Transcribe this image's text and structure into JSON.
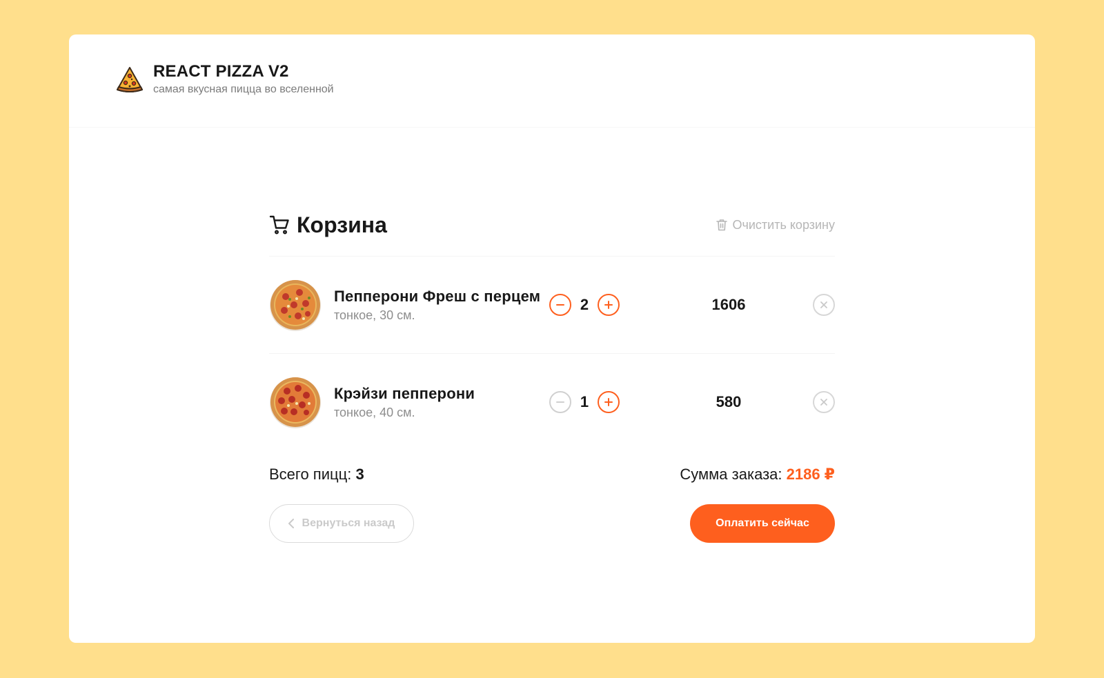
{
  "header": {
    "logo_icon": "pizza-slice-icon",
    "title": "REACT PIZZA V2",
    "subtitle": "самая вкусная пицца во вселенной"
  },
  "cart": {
    "title": "Корзина",
    "title_icon": "cart-icon",
    "clear_label": "Очистить корзину",
    "clear_icon": "trash-icon",
    "items": [
      {
        "name": "Пепперони Фреш с перцем",
        "desc": "тонкое, 30 см.",
        "count": "2",
        "price": "1606",
        "image_icon": "pizza-image",
        "minus_disabled": false
      },
      {
        "name": "Крэйзи пепперони",
        "desc": "тонкое, 40 см.",
        "count": "1",
        "price": "580",
        "image_icon": "pizza-image",
        "minus_disabled": true
      }
    ],
    "total_count_label": "Всего пицц: ",
    "total_count": "3",
    "total_sum_label": "Сумма заказа: ",
    "total_sum": "2186 ₽",
    "back_label": "Вернуться назад",
    "pay_label": "Оплатить сейчас"
  },
  "colors": {
    "background": "#FFDF8C",
    "accent": "#FE5F1E",
    "muted": "#B6B6B6"
  }
}
